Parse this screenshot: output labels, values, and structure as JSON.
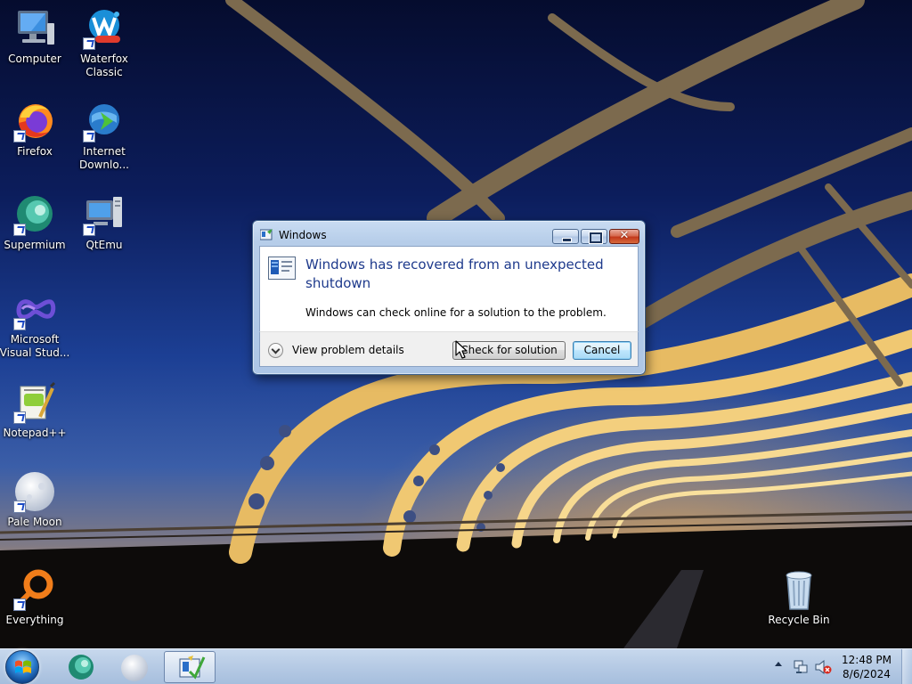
{
  "desktop": {
    "icons": [
      {
        "label": "Computer",
        "icon": "computer-icon"
      },
      {
        "label": "Waterfox\nClassic",
        "icon": "waterfox-classic-icon"
      },
      {
        "label": "Firefox",
        "icon": "firefox-icon"
      },
      {
        "label": "Internet\nDownlo...",
        "icon": "internet-download-manager-icon"
      },
      {
        "label": "Supermium",
        "icon": "supermium-icon"
      },
      {
        "label": "QtEmu",
        "icon": "qtemu-icon"
      },
      {
        "label": "Microsoft\nVisual Stud...",
        "icon": "visual-studio-icon"
      },
      {
        "label": "Notepad++",
        "icon": "notepad-plus-plus-icon"
      },
      {
        "label": "Pale Moon",
        "icon": "pale-moon-icon"
      },
      {
        "label": "Everything",
        "icon": "everything-icon"
      },
      {
        "label": "Recycle Bin",
        "icon": "recycle-bin-icon"
      }
    ]
  },
  "dialog": {
    "title": "Windows",
    "heading": "Windows has recovered from an unexpected shutdown",
    "message": "Windows can check online for a solution to the problem.",
    "details_label": "View problem details",
    "check_button": "Check for solution",
    "cancel_button": "Cancel",
    "close_glyph": "✕"
  },
  "taskbar": {
    "items": [
      "supermium-icon",
      "pale-moon-icon",
      "windows-error-reporting-icon"
    ],
    "clock": {
      "time": "12:48 PM",
      "date": "8/6/2024"
    }
  },
  "colors": {
    "heading_blue": "#1e3a8c",
    "taskbar": "#b9cde6",
    "dialog_frame": "#adc6e6"
  }
}
